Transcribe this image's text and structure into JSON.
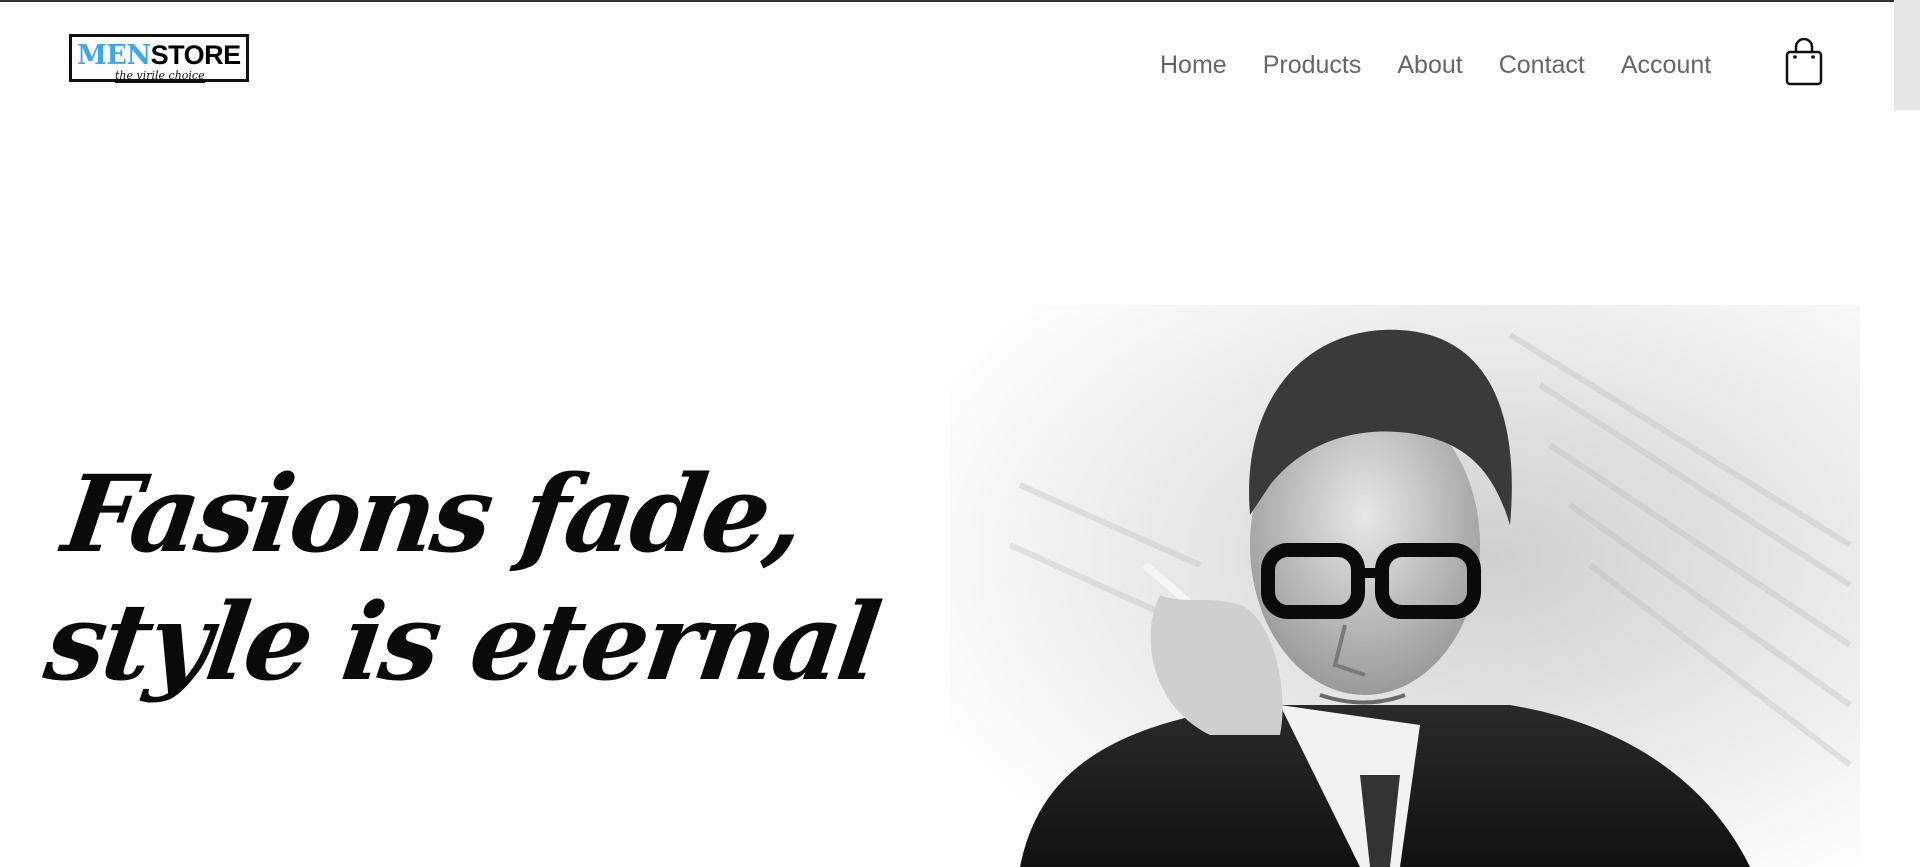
{
  "brand": {
    "logo_men": "MEN",
    "logo_store": "STORE",
    "tagline": "the virile choice",
    "accent_color": "#3ea6ef"
  },
  "nav": {
    "items": [
      {
        "label": "Home"
      },
      {
        "label": "Products"
      },
      {
        "label": "About"
      },
      {
        "label": "Contact"
      },
      {
        "label": "Account"
      }
    ],
    "cart_icon": "shopping-bag-icon"
  },
  "hero": {
    "headline_line1": "Fasions fade,",
    "headline_line2": "style is eternal",
    "image_subject": "black-and-white portrait of man with glasses holding cigarette"
  }
}
